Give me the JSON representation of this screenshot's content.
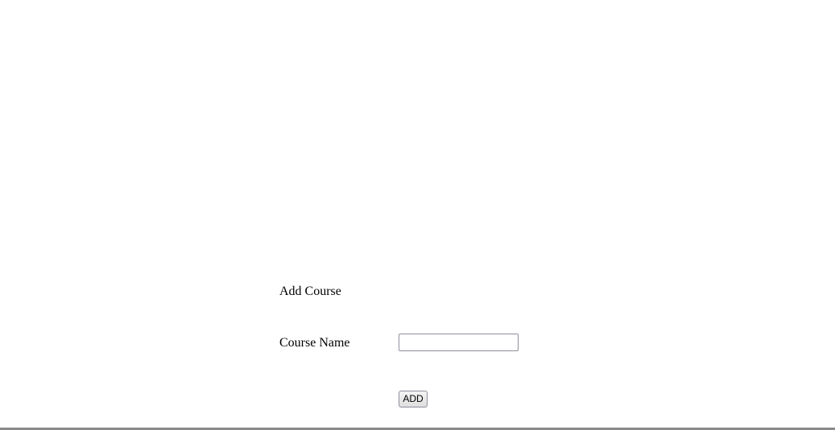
{
  "form": {
    "title": "Add Course",
    "course_name_label": "Course Name",
    "course_name_value": "",
    "course_name_placeholder": "",
    "add_button_label": "ADD"
  }
}
